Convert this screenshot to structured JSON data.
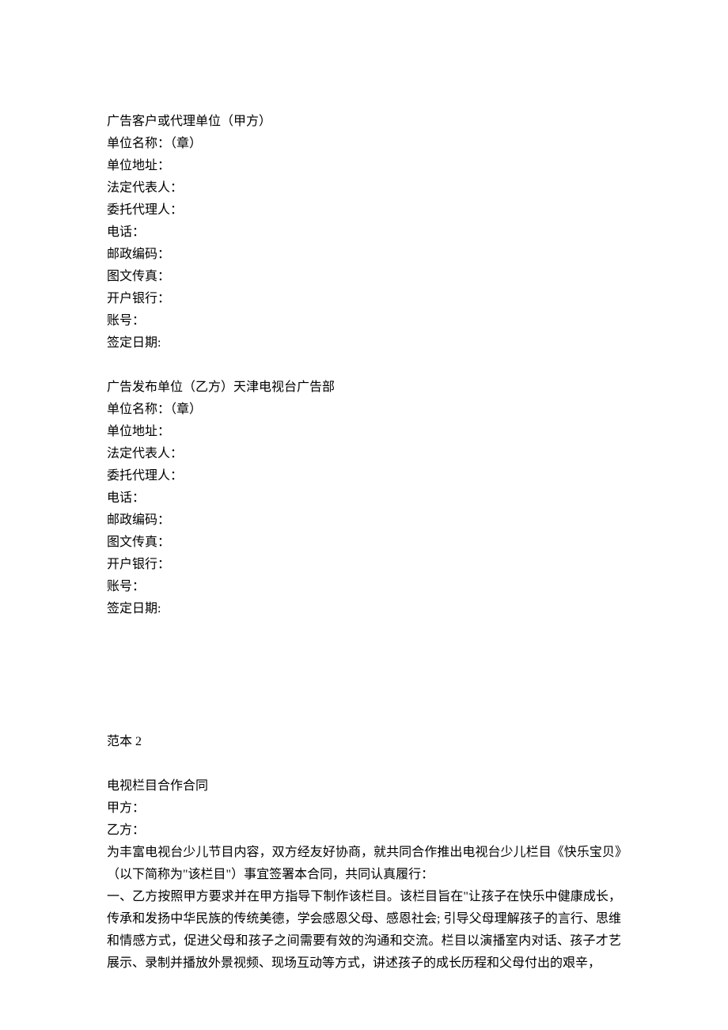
{
  "partyA": {
    "header": "广告客户或代理单位（甲方）",
    "fields": [
      "单位名称：（章）",
      "单位地址：",
      "法定代表人：",
      "委托代理人：",
      "电话：",
      "邮政编码：",
      "图文传真：",
      "开户银行：",
      "账号：",
      "签定日期:"
    ]
  },
  "partyB": {
    "header": "广告发布单位（乙方）天津电视台广告部",
    "fields": [
      "单位名称：（章）",
      "单位地址：",
      "法定代表人：",
      "委托代理人：",
      "电话：",
      "邮政编码：",
      "图文传真：",
      "开户银行：",
      "账号：",
      "签定日期:"
    ]
  },
  "template2": {
    "label": "范本 2",
    "title": "电视栏目合作合同",
    "partyA": "甲方：",
    "partyB": "乙方：",
    "intro": "为丰富电视台少儿节目内容，双方经友好协商，就共同合作推出电视台少儿栏目《快乐宝贝》（以下简称为\"该栏目\"）事宜签署本合同，共同认真履行：",
    "clause1": "一、乙方按照甲方要求并在甲方指导下制作该栏目。该栏目旨在\"让孩子在快乐中健康成长，传承和发扬中华民族的传统美德，学会感恩父母、感恩社会; 引导父母理解孩子的言行、思维和情感方式，促进父母和孩子之间需要有效的沟通和交流。栏目以演播室内对话、孩子才艺展示、录制并播放外景视频、现场互动等方式，讲述孩子的成长历程和父母付出的艰辛，"
  }
}
